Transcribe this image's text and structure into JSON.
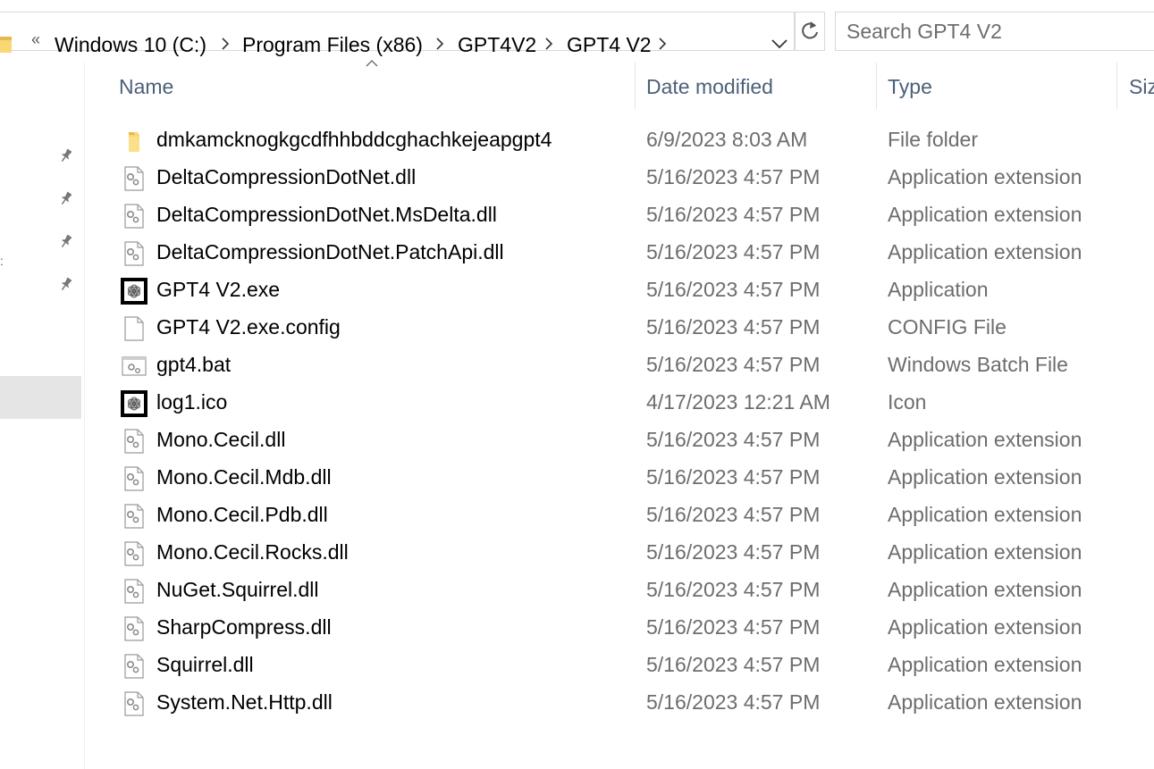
{
  "address_bar": {
    "overflow_glyph": "«",
    "crumbs": [
      "Windows 10 (C:)",
      "Program Files (x86)",
      "GPT4V2",
      "GPT4 V2"
    ],
    "separator_icon": "chevron-right-icon",
    "history_icon": "chevron-down-icon",
    "refresh_icon": "refresh-icon"
  },
  "search": {
    "placeholder": "Search GPT4 V2",
    "value": ""
  },
  "columns": {
    "name": "Name",
    "date_modified": "Date modified",
    "type": "Type",
    "size": "Size",
    "sorted_by": "Name"
  },
  "files": [
    {
      "name": "dmkamcknogkgcdfhhbddcghachkejeapgpt4",
      "date": "6/9/2023 8:03 AM",
      "type": "File folder",
      "icon": "folder-icon"
    },
    {
      "name": "DeltaCompressionDotNet.dll",
      "date": "5/16/2023 4:57 PM",
      "type": "Application extension",
      "icon": "dll-icon"
    },
    {
      "name": "DeltaCompressionDotNet.MsDelta.dll",
      "date": "5/16/2023 4:57 PM",
      "type": "Application extension",
      "icon": "dll-icon"
    },
    {
      "name": "DeltaCompressionDotNet.PatchApi.dll",
      "date": "5/16/2023 4:57 PM",
      "type": "Application extension",
      "icon": "dll-icon"
    },
    {
      "name": "GPT4 V2.exe",
      "date": "5/16/2023 4:57 PM",
      "type": "Application",
      "icon": "app-logo-icon"
    },
    {
      "name": "GPT4 V2.exe.config",
      "date": "5/16/2023 4:57 PM",
      "type": "CONFIG File",
      "icon": "blank-file-icon"
    },
    {
      "name": "gpt4.bat",
      "date": "5/16/2023 4:57 PM",
      "type": "Windows Batch File",
      "icon": "batch-file-icon"
    },
    {
      "name": "log1.ico",
      "date": "4/17/2023 12:21 AM",
      "type": "Icon",
      "icon": "app-logo-icon"
    },
    {
      "name": "Mono.Cecil.dll",
      "date": "5/16/2023 4:57 PM",
      "type": "Application extension",
      "icon": "dll-icon"
    },
    {
      "name": "Mono.Cecil.Mdb.dll",
      "date": "5/16/2023 4:57 PM",
      "type": "Application extension",
      "icon": "dll-icon"
    },
    {
      "name": "Mono.Cecil.Pdb.dll",
      "date": "5/16/2023 4:57 PM",
      "type": "Application extension",
      "icon": "dll-icon"
    },
    {
      "name": "Mono.Cecil.Rocks.dll",
      "date": "5/16/2023 4:57 PM",
      "type": "Application extension",
      "icon": "dll-icon"
    },
    {
      "name": "NuGet.Squirrel.dll",
      "date": "5/16/2023 4:57 PM",
      "type": "Application extension",
      "icon": "dll-icon"
    },
    {
      "name": "SharpCompress.dll",
      "date": "5/16/2023 4:57 PM",
      "type": "Application extension",
      "icon": "dll-icon"
    },
    {
      "name": "Squirrel.dll",
      "date": "5/16/2023 4:57 PM",
      "type": "Application extension",
      "icon": "dll-icon"
    },
    {
      "name": "System.Net.Http.dll",
      "date": "5/16/2023 4:57 PM",
      "type": "Application extension",
      "icon": "dll-icon"
    }
  ],
  "nav_pane": {
    "pin_icon": "pin-icon",
    "pinned_count": 4
  },
  "colors": {
    "header_text": "#4c607a",
    "secondary_text": "#6d6d6d",
    "folder_yellow": "#f8d775",
    "selection_gray": "#e5e5e5"
  }
}
